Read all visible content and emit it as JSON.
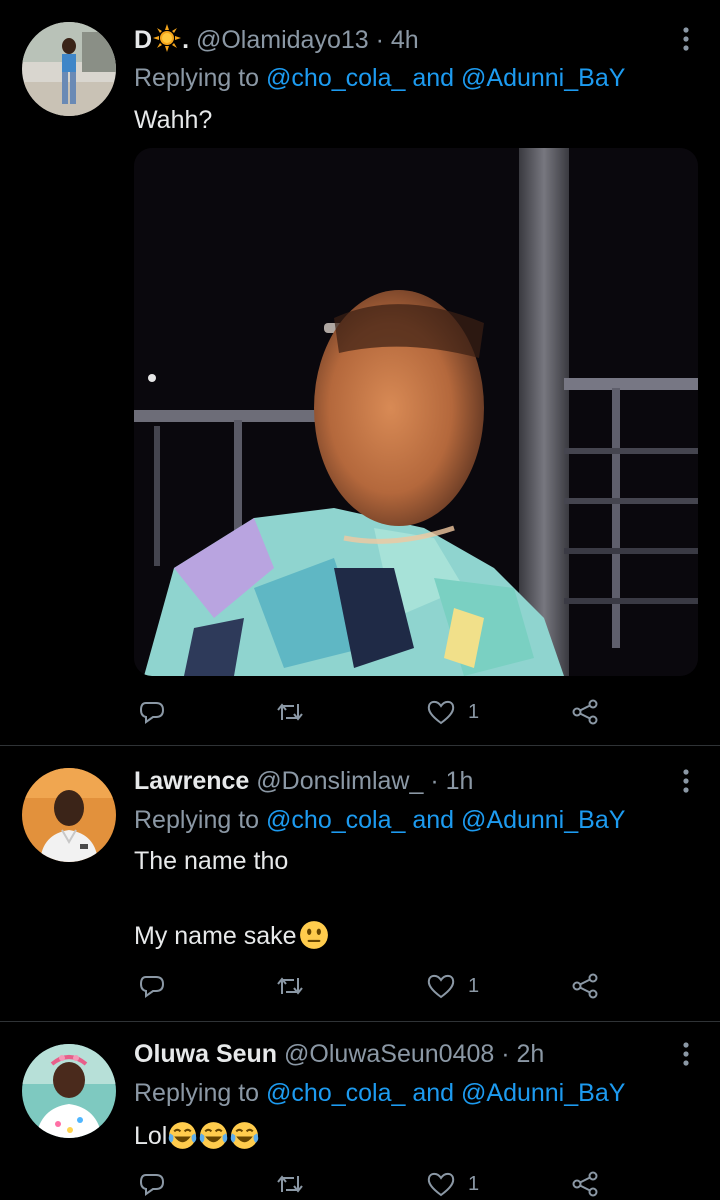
{
  "tweets": [
    {
      "name": "D",
      "name_suffix": ".",
      "handle": "@Olamidayo13",
      "separator": "·",
      "time": "4h",
      "replying_prefix": "Replying to",
      "mention1": "@cho_cola_",
      "conjunction": "and",
      "mention2": "@Adunni_BaY",
      "text_lines": [
        "Wahh?"
      ],
      "has_media": true,
      "like_count": "1"
    },
    {
      "name": "Lawrence",
      "handle": "@Donslimlaw_",
      "separator": "·",
      "time": "1h",
      "replying_prefix": "Replying to",
      "mention1": "@cho_cola_",
      "conjunction": "and",
      "mention2": "@Adunni_BaY",
      "text_lines": [
        "The name tho",
        "My name sake"
      ],
      "like_count": "1"
    },
    {
      "name": "Oluwa Seun",
      "handle": "@OluwaSeun0408",
      "separator": "·",
      "time": "2h",
      "replying_prefix": "Replying to",
      "mention1": "@cho_cola_",
      "conjunction": "and",
      "mention2": "@Adunni_BaY",
      "text_lines": [
        "Lol"
      ],
      "like_count": "1"
    }
  ],
  "icons": {
    "reply": "reply-icon",
    "retweet": "retweet-icon",
    "like": "heart-icon",
    "share": "share-icon",
    "more": "more-vertical-icon"
  },
  "colors": {
    "background": "#000000",
    "text": "#e7e9ea",
    "secondary": "#8b98a5",
    "link": "#1d9bf0",
    "divider": "#2f3336"
  }
}
